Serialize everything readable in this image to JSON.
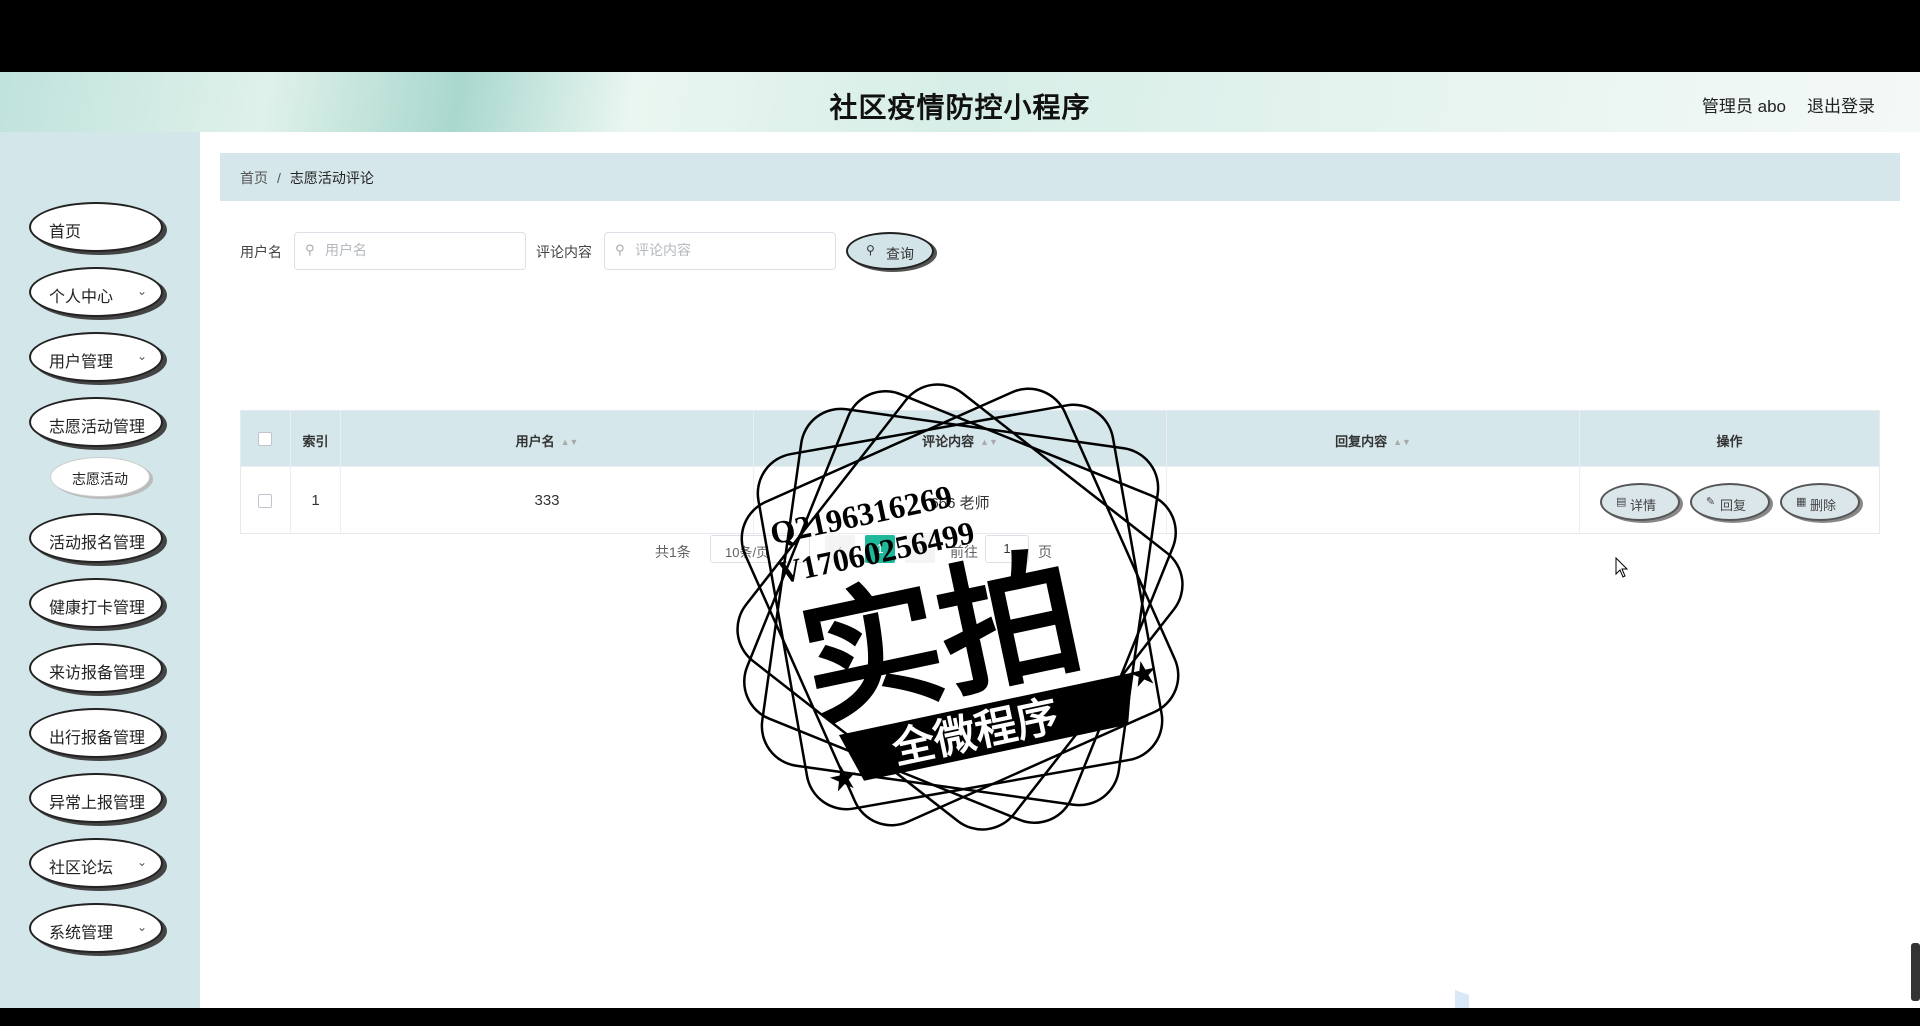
{
  "header": {
    "title": "社区疫情防控小程序",
    "user": "管理员 abo",
    "logout": "退出登录"
  },
  "sidebar": {
    "items": [
      {
        "label": "首页",
        "chevron": false
      },
      {
        "label": "个人中心",
        "chevron": true
      },
      {
        "label": "用户管理",
        "chevron": true
      },
      {
        "label": "志愿活动管理",
        "chevron": false
      },
      {
        "label": "志愿活动",
        "submenu": true
      },
      {
        "label": "活动报名管理",
        "chevron": false
      },
      {
        "label": "健康打卡管理",
        "chevron": false
      },
      {
        "label": "来访报备管理",
        "chevron": false
      },
      {
        "label": "出行报备管理",
        "chevron": false
      },
      {
        "label": "异常上报管理",
        "chevron": false
      },
      {
        "label": "社区论坛",
        "chevron": true
      },
      {
        "label": "系统管理",
        "chevron": true
      }
    ]
  },
  "breadcrumb": {
    "home": "首页",
    "separator": "/",
    "current": "志愿活动评论"
  },
  "search": {
    "username_label": "用户名",
    "username_placeholder": "用户名",
    "content_label": "评论内容",
    "content_placeholder": "评论内容",
    "query_button": "查询"
  },
  "table": {
    "columns": [
      "索引",
      "用户名",
      "评论内容",
      "回复内容",
      "操作"
    ],
    "rows": [
      {
        "index": "1",
        "username": "333",
        "content": "666 老师",
        "reply": ""
      }
    ],
    "actions": {
      "detail": "详情",
      "reply": "回复",
      "delete": "删除"
    }
  },
  "pagination": {
    "total": "共1条",
    "page_size": "10条/页",
    "current_page": "1",
    "goto_label": "前往",
    "goto_value": "1",
    "page_unit": "页"
  },
  "watermark": {
    "qq": "Q2196316269",
    "wx": "V17060256499",
    "main": "实拍",
    "banner": "全微程序"
  },
  "colors": {
    "accent": "#1eb89a",
    "sidebar_bg": "#d3e6ea",
    "header_bg": "#d5e7eb"
  }
}
